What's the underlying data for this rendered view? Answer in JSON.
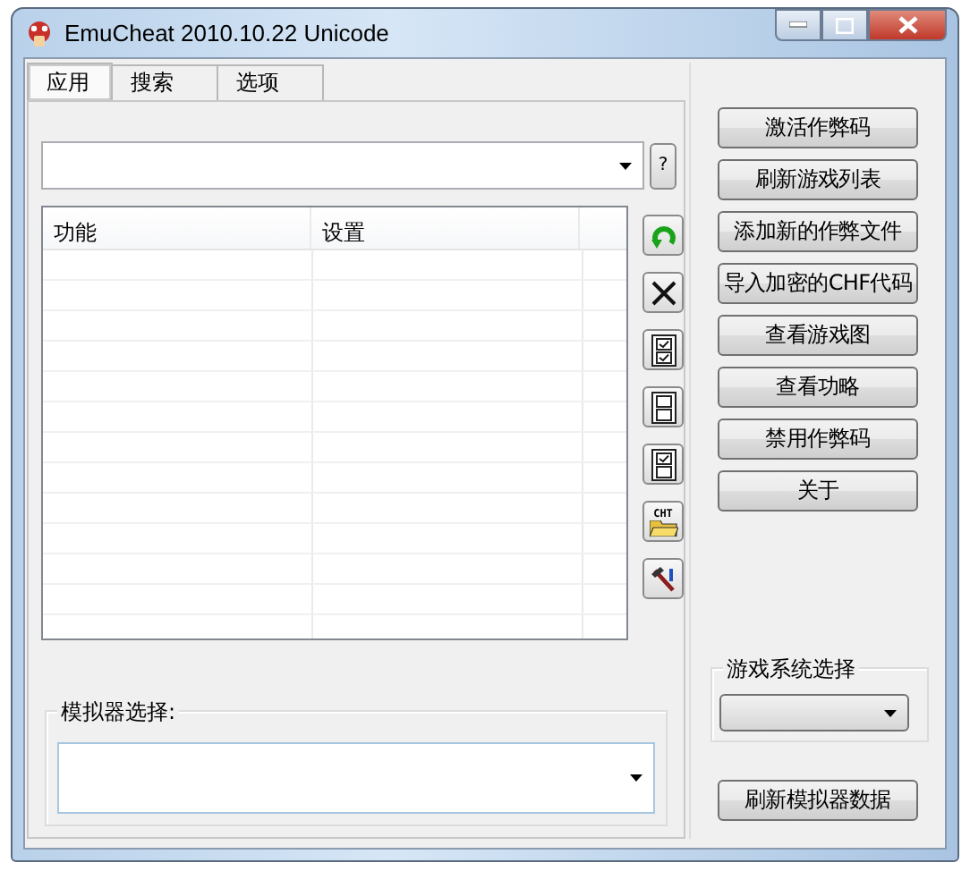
{
  "window": {
    "title": "EmuCheat 2010.10.22 Unicode"
  },
  "tabs": [
    {
      "label": "应用",
      "selected": true
    },
    {
      "label": "搜索",
      "selected": false
    },
    {
      "label": "选项",
      "selected": false
    }
  ],
  "help_button": "?",
  "table": {
    "columns": [
      "功能",
      "设置"
    ]
  },
  "tool_buttons": [
    {
      "kind": "refresh"
    },
    {
      "kind": "delete"
    },
    {
      "kind": "check-all"
    },
    {
      "kind": "uncheck-all"
    },
    {
      "kind": "check-some"
    },
    {
      "kind": "folder",
      "label": "CHT"
    },
    {
      "kind": "tools"
    }
  ],
  "side_buttons": [
    "激活作弊码",
    "刷新游戏列表",
    "添加新的作弊文件",
    "导入加密的CHF代码",
    "查看游戏图",
    "查看功略",
    "禁用作弊码",
    "关于"
  ],
  "system_group": {
    "label": "游戏系统选择"
  },
  "refresh_emulator_button": "刷新模拟器数据",
  "emulator_group": {
    "label": "模拟器选择:"
  }
}
